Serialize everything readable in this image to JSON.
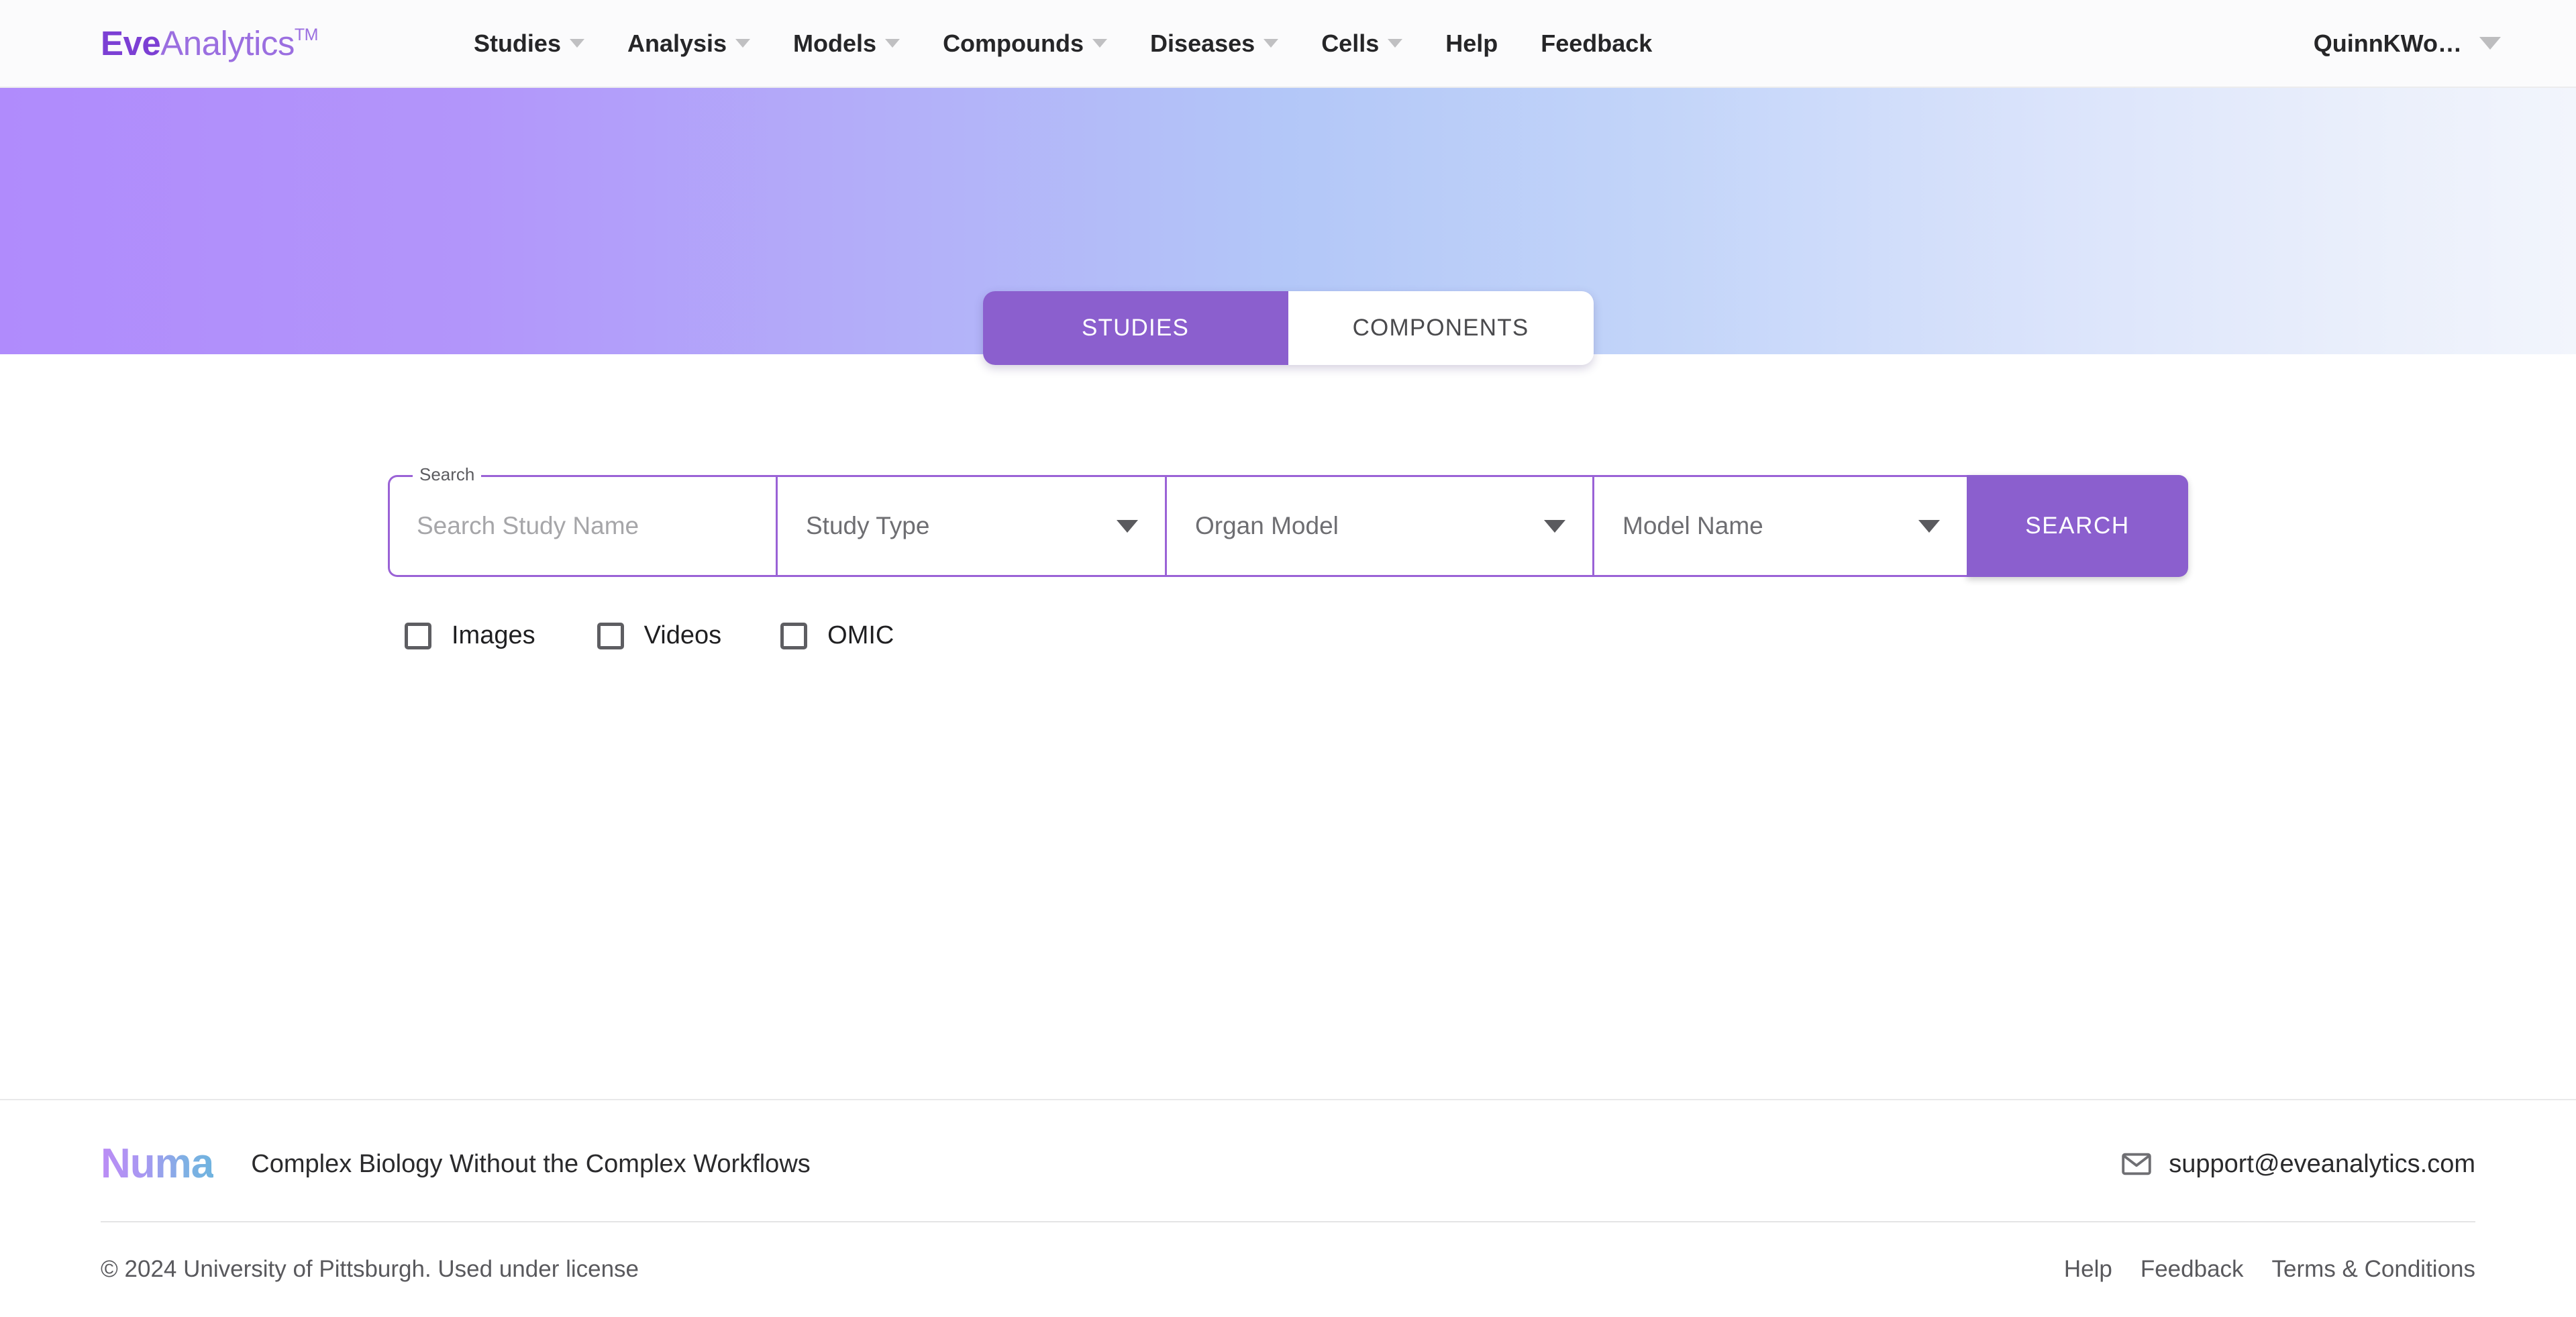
{
  "brand": {
    "primary": "Eve",
    "secondary": "Analytics",
    "trademark": "TM"
  },
  "navbar": {
    "items": [
      {
        "label": "Studies",
        "has_dropdown": true,
        "icon": "chevron-down-icon"
      },
      {
        "label": "Analysis",
        "has_dropdown": true,
        "icon": "chevron-down-icon"
      },
      {
        "label": "Models",
        "has_dropdown": true,
        "icon": "chevron-down-icon"
      },
      {
        "label": "Compounds",
        "has_dropdown": true,
        "icon": "chevron-down-icon"
      },
      {
        "label": "Diseases",
        "has_dropdown": true,
        "icon": "chevron-down-icon"
      },
      {
        "label": "Cells",
        "has_dropdown": true,
        "icon": "chevron-down-icon"
      },
      {
        "label": "Help",
        "has_dropdown": false,
        "icon": ""
      },
      {
        "label": "Feedback",
        "has_dropdown": false,
        "icon": ""
      }
    ],
    "user_menu": {
      "label": "QuinnKWo…",
      "icon": "chevron-down-icon"
    }
  },
  "hero": {
    "gradient_start": "#b08bfc",
    "gradient_mid": "#b3c7f8",
    "gradient_end": "#f2f5fc"
  },
  "tabs": {
    "active_index": 0,
    "items": [
      {
        "label": "STUDIES",
        "active": true
      },
      {
        "label": "COMPONENTS",
        "active": false
      }
    ],
    "active_color": "#8b5fce",
    "inactive_bg": "#ffffff"
  },
  "search": {
    "legend": "Search",
    "name_input": {
      "value": "",
      "placeholder": "Search Study Name"
    },
    "selects": [
      {
        "name": "study-type",
        "value": "Study Type",
        "icon": "dropdown-arrow-icon"
      },
      {
        "name": "organ-model",
        "value": "Organ Model",
        "icon": "dropdown-arrow-icon"
      },
      {
        "name": "model-name",
        "value": "Model Name",
        "icon": "dropdown-arrow-icon"
      }
    ],
    "submit_label": "SEARCH",
    "accent_color": "#8b5fce",
    "border_color": "#9a62d6",
    "checkboxes": [
      {
        "label": "Images",
        "checked": false
      },
      {
        "label": "Videos",
        "checked": false
      },
      {
        "label": "OMIC",
        "checked": false
      }
    ]
  },
  "footer": {
    "logo": "Numa",
    "tagline": "Complex Biology Without the Complex Workflows",
    "email": "support@eveanalytics.com",
    "email_icon": "mail-icon",
    "copyright": "© 2024 University of Pittsburgh. Used under license",
    "links": [
      {
        "label": "Help"
      },
      {
        "label": "Feedback"
      },
      {
        "label": "Terms & Conditions"
      }
    ]
  }
}
